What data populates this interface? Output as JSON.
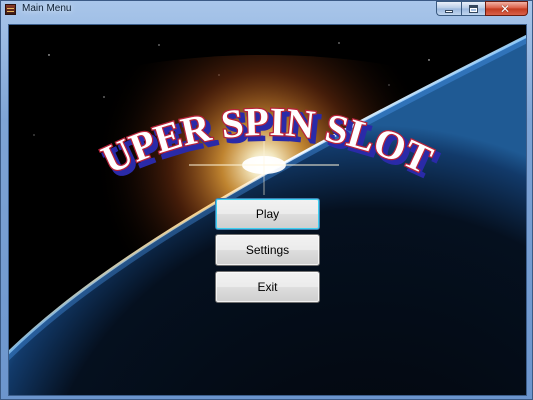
{
  "window": {
    "title": "Main Menu",
    "caption_buttons": [
      "minimize",
      "maximize",
      "close"
    ]
  },
  "logo": {
    "text": "SUPER SPIN SLOTS"
  },
  "menu": {
    "play_label": "Play",
    "settings_label": "Settings",
    "exit_label": "Exit",
    "focused": "Play"
  },
  "colors": {
    "logo_fill": "#ffffff",
    "logo_outline": "#b8233a",
    "logo_shadow": "#2a2aa8",
    "background": "#000000",
    "horizon_glow": "#ffb040"
  }
}
